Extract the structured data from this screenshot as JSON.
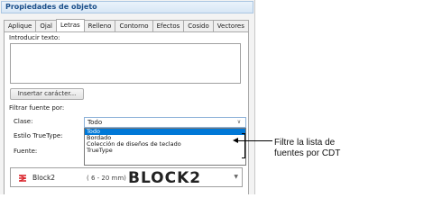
{
  "window": {
    "title": "Propiedades de objeto"
  },
  "tabs": [
    {
      "label": "Aplique"
    },
    {
      "label": "Ojal"
    },
    {
      "label": "Letras"
    },
    {
      "label": "Relleno"
    },
    {
      "label": "Contorno"
    },
    {
      "label": "Efectos"
    },
    {
      "label": "Cosido"
    },
    {
      "label": "Vectores"
    }
  ],
  "active_tab": "Letras",
  "text_input": {
    "label": "Introducir texto:",
    "value": ""
  },
  "insert_button": {
    "label": "Insertar carácter..."
  },
  "filter": {
    "section_label": "Filtrar fuente por:",
    "class_label": "Clase:",
    "class_value": "Todo",
    "truetype_label": "Estilo TrueType:",
    "options": [
      "Todo",
      "Bordado",
      "Colección de diseños de teclado",
      "TrueType"
    ]
  },
  "font": {
    "label": "Fuente:",
    "name": "Block2",
    "size_range": "( 6 - 20 mm)",
    "preview": "BLOCK2"
  },
  "callout": {
    "line1": "Filtre la lista de",
    "line2": "fuentes por CDT"
  }
}
